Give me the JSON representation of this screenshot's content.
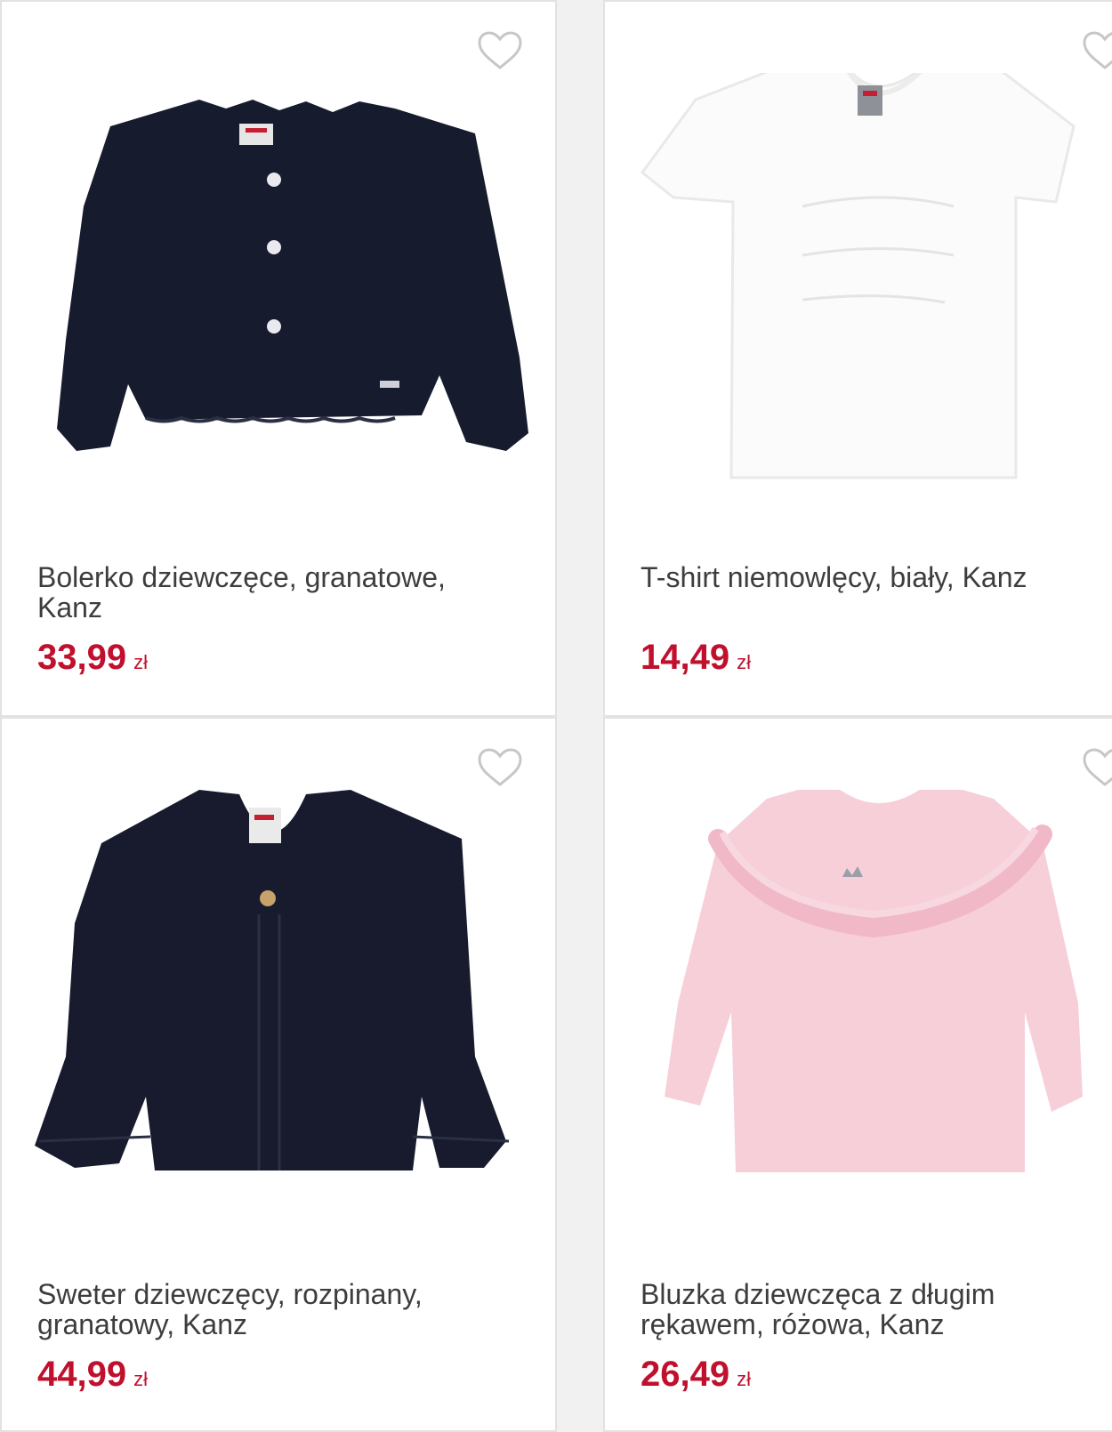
{
  "products": [
    {
      "title": "Bolerko dziewczęce, granatowe, Kanz",
      "price": "33,99",
      "currency": "zł",
      "color": "#161b2e",
      "image": "navy-bolero-cardigan"
    },
    {
      "title": "T-shirt niemowlęcy, biały, Kanz",
      "price": "14,49",
      "currency": "zł",
      "color": "#fbfbfb",
      "image": "white-tshirt"
    },
    {
      "title": "Sweter dziewczęcy, rozpinany, granatowy, Kanz",
      "price": "44,99",
      "currency": "zł",
      "color": "#171b2d",
      "image": "navy-cardigan-sweater"
    },
    {
      "title": "Bluzka dziewczęca z długim rękawem, różowa, Kanz",
      "price": "26,49",
      "currency": "zł",
      "color": "#f6cfd9",
      "image": "pink-ruffle-blouse"
    }
  ],
  "icons": {
    "wishlist": "heart-outline-icon"
  },
  "colors": {
    "price": "#c0102d",
    "title": "#3d3d3d",
    "border": "#e2e2e2",
    "background": "#f1f1f1"
  }
}
